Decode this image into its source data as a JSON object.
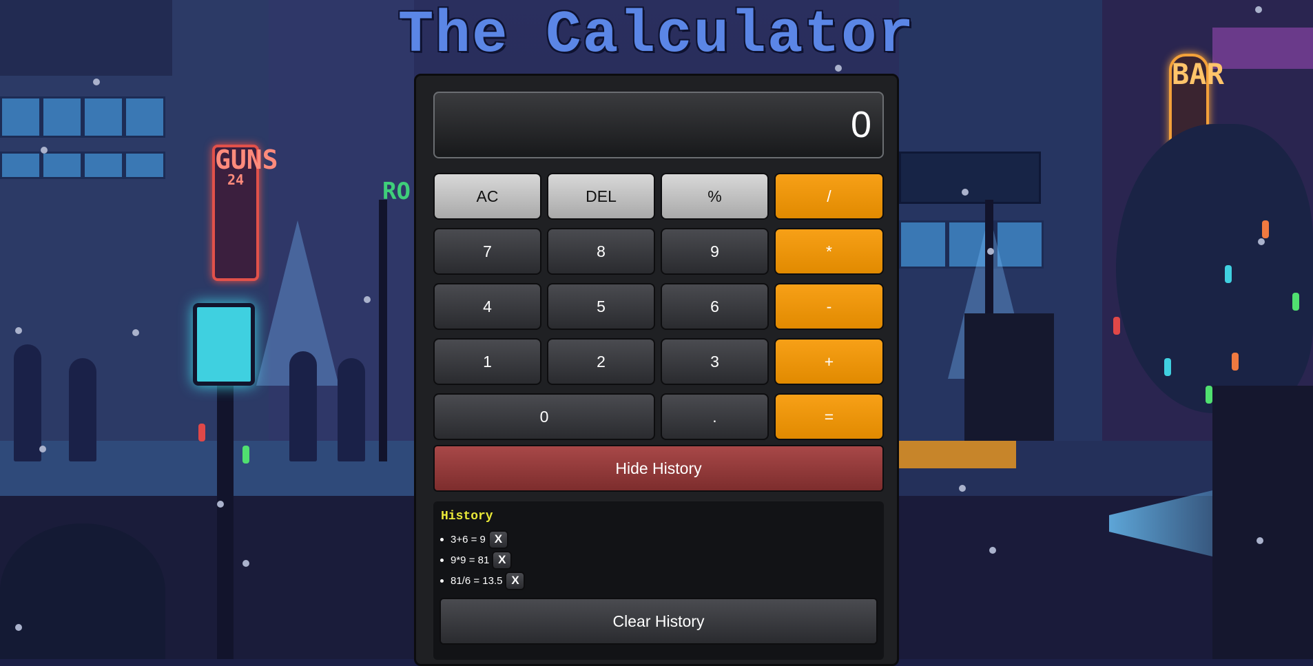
{
  "page": {
    "title": "The Calculator",
    "background_signs": [
      "GUNS",
      "24",
      "BAR",
      "RO"
    ]
  },
  "calculator": {
    "display_value": "0",
    "keys": {
      "ac": "AC",
      "del": "DEL",
      "percent": "%",
      "divide": "/",
      "seven": "7",
      "eight": "8",
      "nine": "9",
      "multiply": "*",
      "four": "4",
      "five": "5",
      "six": "6",
      "subtract": "-",
      "one": "1",
      "two": "2",
      "three": "3",
      "add": "+",
      "zero": "0",
      "decimal": ".",
      "equals": "="
    },
    "hide_history_label": "Hide History"
  },
  "history": {
    "title": "History",
    "entries": [
      {
        "expression": "3+6 = 9",
        "remove_label": "X"
      },
      {
        "expression": "9*9 = 81",
        "remove_label": "X"
      },
      {
        "expression": "81/6 = 13.5",
        "remove_label": "X"
      }
    ],
    "clear_label": "Clear History"
  },
  "colors": {
    "accent_orange": "#f7a017",
    "function_grey": "#c4c4c4",
    "hide_history_red": "#9a3f3f",
    "history_title_yellow": "#e8e838",
    "title_blue": "#5b86e6"
  }
}
